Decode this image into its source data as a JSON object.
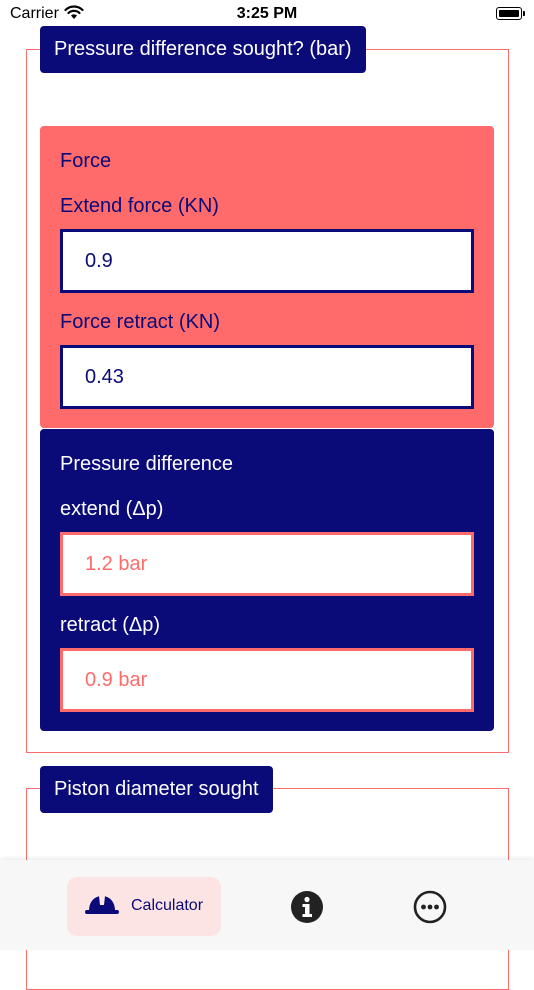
{
  "status_bar": {
    "carrier": "Carrier",
    "time": "3:25 PM"
  },
  "section_pressure": {
    "title": "Pressure difference sought? (bar)",
    "force_panel": {
      "heading": "Force",
      "extend_label": "Extend force (KN)",
      "extend_value": "0.9",
      "retract_label": "Force retract (KN)",
      "retract_value": "0.43"
    },
    "result_panel": {
      "heading": "Pressure difference",
      "extend_label": "extend (Δp)",
      "extend_value": "1.2 bar",
      "retract_label": "retract (Δp)",
      "retract_value": "0.9 bar"
    }
  },
  "section_piston": {
    "title": "Piston diameter sought"
  },
  "tab_bar": {
    "calculator_label": "Calculator",
    "calculator_icon": "hard-hat-icon",
    "info_icon": "info-icon",
    "more_icon": "more-icon"
  },
  "colors": {
    "navy": "#0a0a78",
    "coral": "#ff6b6b",
    "tab_highlight": "#fde4e4"
  }
}
